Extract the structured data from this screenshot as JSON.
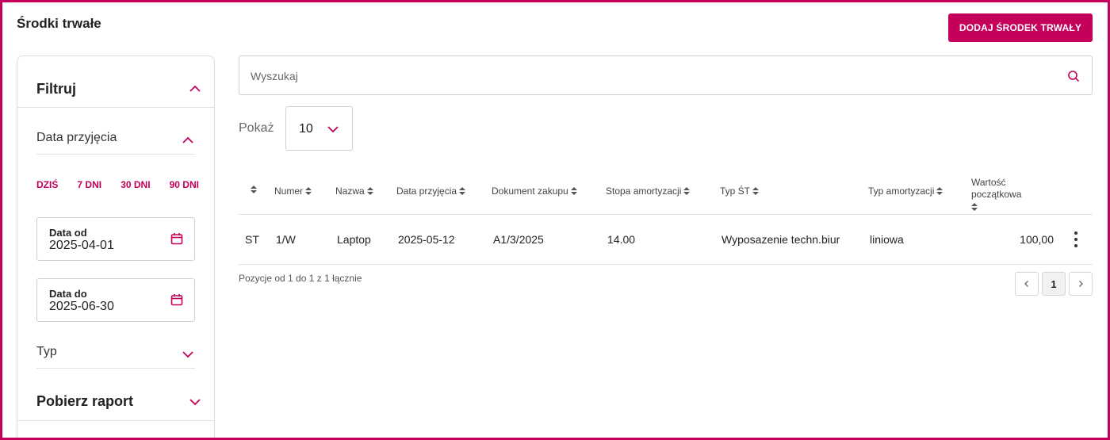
{
  "header": {
    "title": "Środki trwałe",
    "add_button_label": "DODAJ ŚRODEK TRWAŁY"
  },
  "sidebar": {
    "filter_title": "Filtruj",
    "date_section": {
      "label": "Data przyjęcia",
      "quick_ranges": [
        "DZIŚ",
        "7 DNI",
        "30 DNI",
        "90 DNI"
      ],
      "date_from": {
        "label": "Data od",
        "value": "2025-04-01"
      },
      "date_to": {
        "label": "Data do",
        "value": "2025-06-30"
      }
    },
    "type_section": {
      "label": "Typ"
    },
    "report_title": "Pobierz raport"
  },
  "search": {
    "placeholder": "Wyszukaj",
    "value": ""
  },
  "page_size": {
    "label": "Pokaż",
    "value": "10"
  },
  "table": {
    "columns": [
      "",
      "Numer",
      "Nazwa",
      "Data przyjęcia",
      "Dokument zakupu",
      "Stopa amortyzacji",
      "Typ ŚT",
      "Typ amortyzacji",
      "Wartość początkowa"
    ],
    "rows": [
      {
        "type": "ST",
        "number": "1/W",
        "name": "Laptop",
        "date": "2025-05-12",
        "document": "A1/3/2025",
        "rate": "14.00",
        "asset_type": "Wyposazenie techn.biur",
        "amort_type": "liniowa",
        "value": "100,00"
      }
    ]
  },
  "footer": {
    "summary": "Pozycje od 1 do 1 z 1 łącznie",
    "current_page": "1"
  },
  "colors": {
    "accent": "#c4005a",
    "border": "#cfcfcf"
  },
  "icons": [
    "chevron-up-icon",
    "chevron-down-icon",
    "calendar-icon",
    "search-icon",
    "sort-icon",
    "kebab-menu-icon",
    "chevron-left-icon",
    "chevron-right-icon"
  ]
}
